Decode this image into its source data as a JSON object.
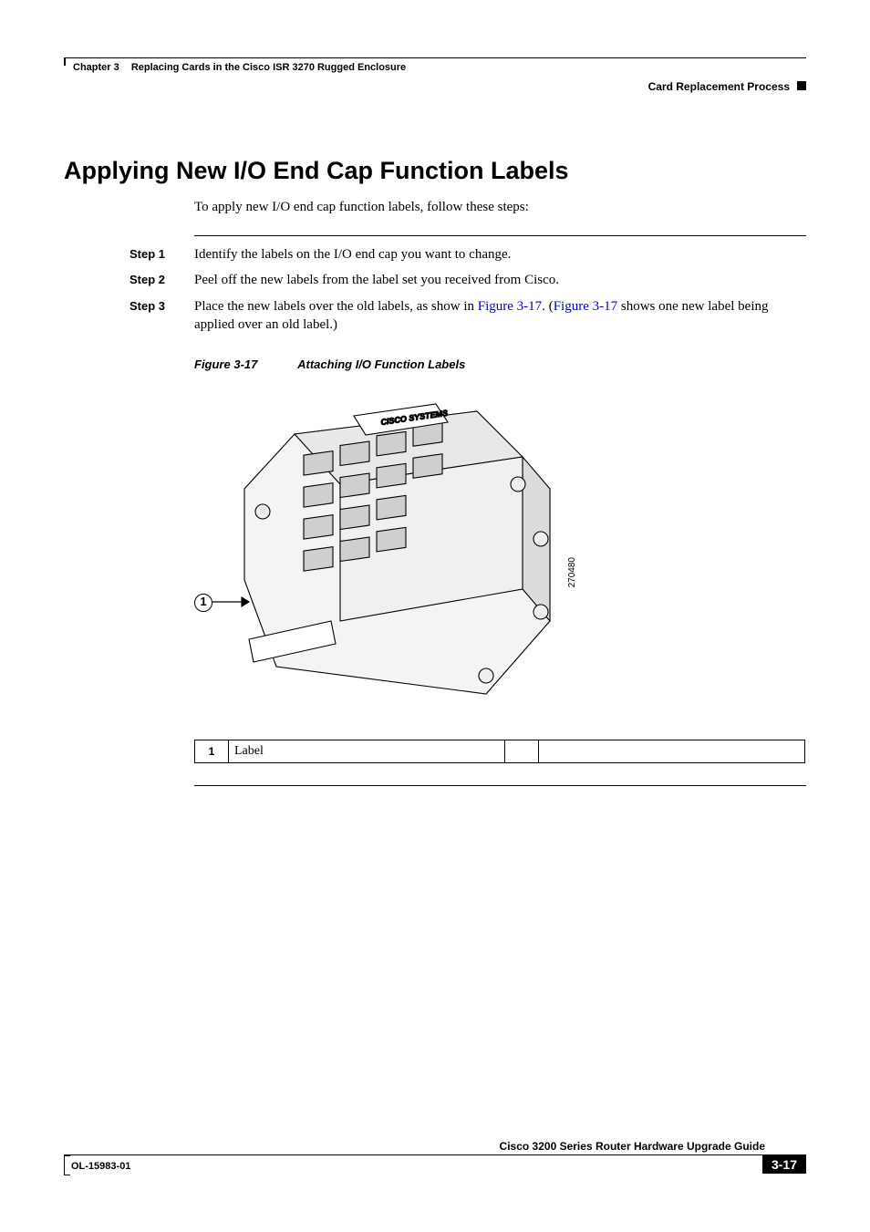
{
  "header": {
    "chapter_label": "Chapter 3",
    "chapter_title": "Replacing Cards in the Cisco ISR 3270 Rugged Enclosure",
    "section": "Card Replacement Process"
  },
  "section_heading": "Applying New I/O End Cap Function Labels",
  "intro": "To apply new I/O end cap function labels, follow these steps:",
  "steps": [
    {
      "label": "Step 1",
      "text": "Identify the labels on the I/O end cap you want to change."
    },
    {
      "label": "Step 2",
      "text": "Peel off the new labels from the label set you received from Cisco."
    },
    {
      "label": "Step 3",
      "prefix": "Place the new labels over the old labels, as show in ",
      "link1": "Figure 3-17",
      "mid": ". (",
      "link2": "Figure 3-17",
      "suffix": " shows one new label being applied over an old label.)"
    }
  ],
  "figure": {
    "number": "Figure 3-17",
    "title": "Attaching I/O Function Labels",
    "callout": "1",
    "drawing_id": "270480"
  },
  "legend": {
    "num": "1",
    "desc": "Label"
  },
  "footer": {
    "doc_title": "Cisco 3200 Series Router Hardware Upgrade Guide",
    "ol": "OL-15983-01",
    "page": "3-17"
  }
}
